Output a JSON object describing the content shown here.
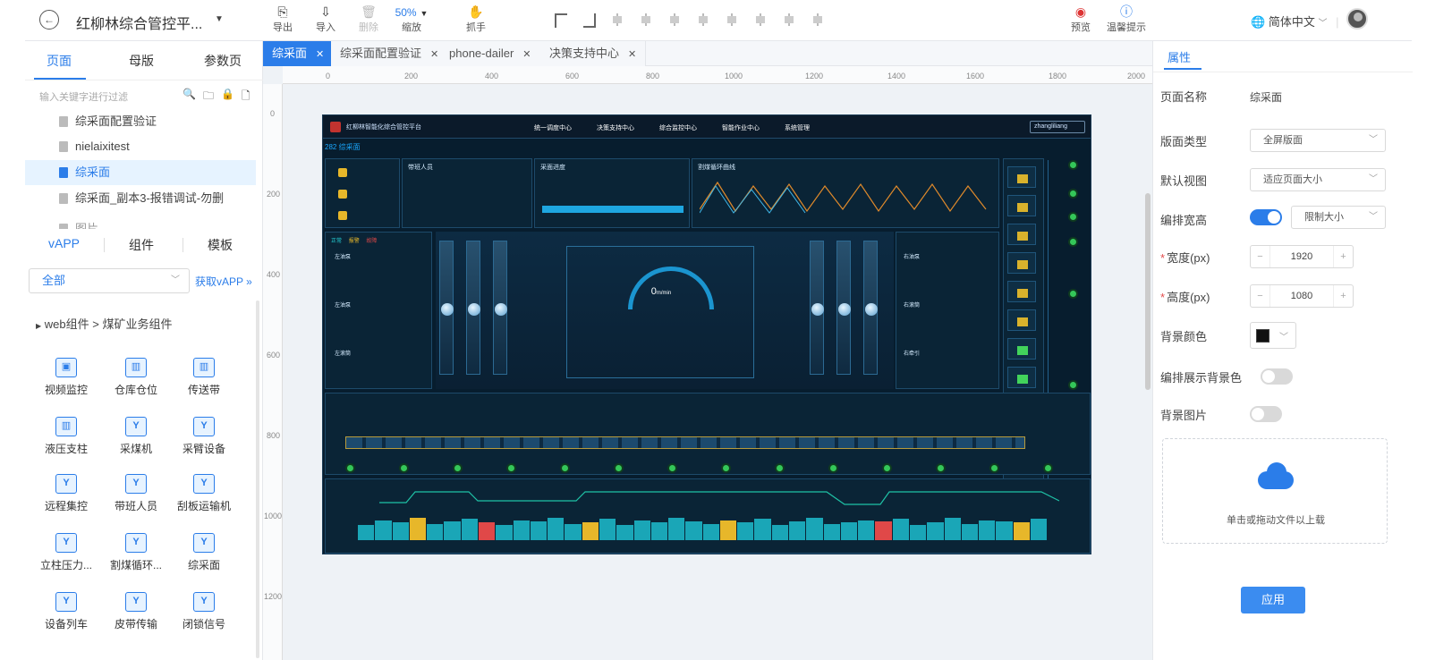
{
  "topbar": {
    "title": "红柳林综合管控平...",
    "tools": [
      {
        "label": "导出",
        "icon": "export-icon"
      },
      {
        "label": "导入",
        "icon": "import-icon"
      },
      {
        "label": "删除",
        "icon": "delete-icon"
      },
      {
        "label": "缩放",
        "icon": "zoom-icon",
        "value": "50%"
      },
      {
        "label": "抓手",
        "icon": "hand-icon"
      }
    ],
    "preview_label": "预览",
    "tips_label": "温馨提示",
    "language": "简体中文"
  },
  "left": {
    "tabs": [
      "页面",
      "母版",
      "参数页"
    ],
    "search_placeholder": "输入关键字进行过滤",
    "pages": [
      "综采面配置验证",
      "nielaixitest",
      "综采面",
      "综采面_副本3-报错调试-勿删",
      "图片"
    ],
    "selected_page": "综采面",
    "lib_tabs": [
      "vAPP",
      "组件",
      "模板"
    ],
    "category": "全部",
    "get_vapp": "获取vAPP",
    "breadcrumb": "web组件 > 煤矿业务组件",
    "components": [
      "视频监控",
      "仓库仓位",
      "传送带",
      "液压支柱",
      "采煤机",
      "采臂设备",
      "远程集控",
      "带班人员",
      "刮板运输机",
      "立柱压力...",
      "割煤循环...",
      "综采面",
      "设备列车",
      "皮带传输",
      "闭锁信号"
    ]
  },
  "center": {
    "doc_tabs": [
      "综采面",
      "综采面配置验证",
      "phone-dailer",
      "决策支持中心"
    ],
    "ruler_x": [
      "0",
      "200",
      "400",
      "600",
      "800",
      "1000",
      "1200",
      "1400",
      "1600",
      "1800",
      "2000"
    ],
    "ruler_y": [
      "0",
      "200",
      "400",
      "600",
      "800",
      "1000",
      "1200"
    ],
    "dashboard": {
      "system_title": "红柳林智能化综合管控平台",
      "nav": [
        "统一调度中心",
        "决策支持中心",
        "综合监控中心",
        "智能作业中心",
        "系统管理"
      ],
      "user": "zhangliliang",
      "page_link": "282 综采面",
      "panels": {
        "personnel": "带班人员",
        "progress": "采面进度",
        "cycle": "割煤循环曲线"
      },
      "speed": "0",
      "speed_unit": "m/min",
      "legend": [
        "正常",
        "报警",
        "故障"
      ],
      "left_labels": [
        "左油泵",
        "左油泵",
        "左滚筒"
      ],
      "right_labels": [
        "右油泵",
        "右滚筒",
        "右牵引"
      ]
    }
  },
  "right": {
    "tab": "属性",
    "page_name_label": "页面名称",
    "page_name": "综采面",
    "layout_type_label": "版面类型",
    "layout_type": "全屏版面",
    "default_view_label": "默认视图",
    "default_view": "适应页面大小",
    "layout_size_label": "编排宽高",
    "layout_size_mode": "限制大小",
    "width_label": "宽度(px)",
    "width": "1920",
    "height_label": "高度(px)",
    "height": "1080",
    "bg_color_label": "背景颜色",
    "bg_color": "#000000",
    "show_bg_label": "编排展示背景色",
    "bg_image_label": "背景图片",
    "upload_text": "单击或拖动文件以上载",
    "apply": "应用"
  },
  "colors": {
    "accent": "#2b7de9",
    "dashboard_bg": "#071d2e"
  }
}
